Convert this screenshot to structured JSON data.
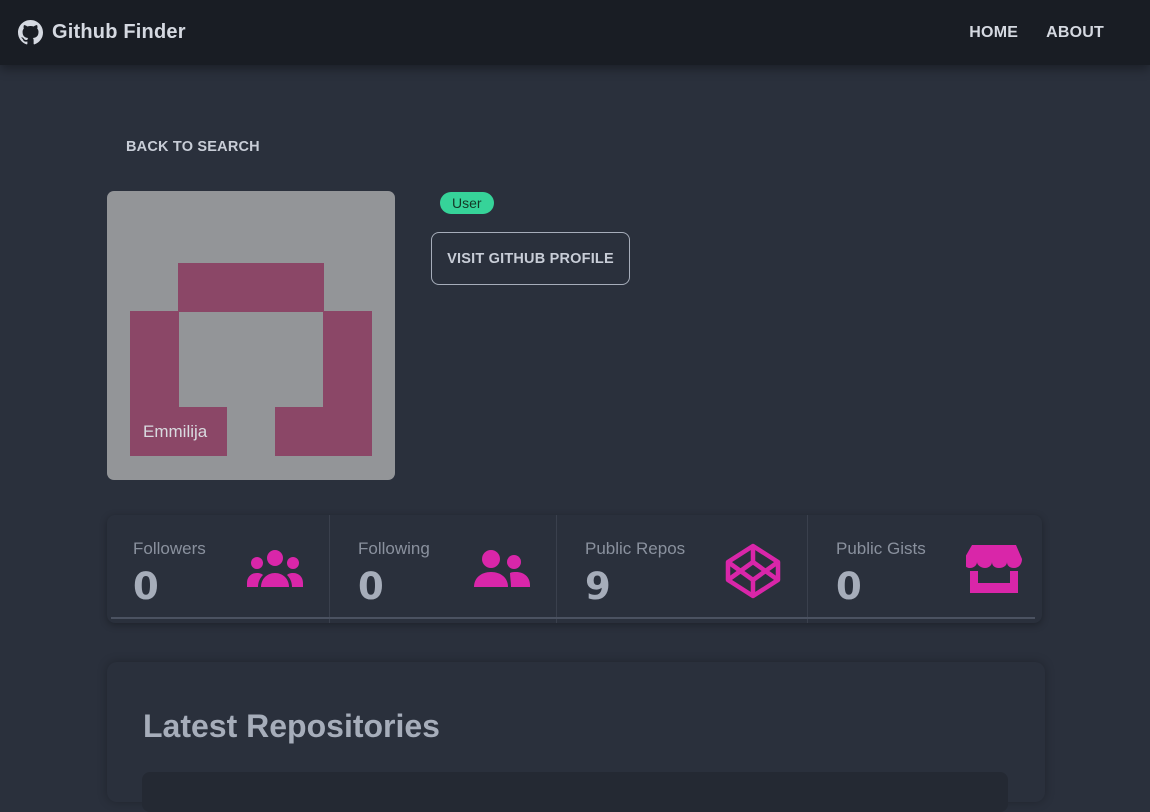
{
  "navbar": {
    "brand": "Github Finder",
    "brand_icon": "github-icon",
    "links": [
      "Home",
      "About"
    ]
  },
  "back_label": "Back To Search",
  "profile": {
    "login": "Emmilija",
    "type_badge": "User",
    "visit_label": "Visit Github Profile"
  },
  "stats": [
    {
      "label": "Followers",
      "value": "0",
      "icon": "users-icon"
    },
    {
      "label": "Following",
      "value": "0",
      "icon": "user-friends-icon"
    },
    {
      "label": "Public Repos",
      "value": "9",
      "icon": "codepen-icon"
    },
    {
      "label": "Public Gists",
      "value": "0",
      "icon": "store-icon"
    }
  ],
  "repos": {
    "title": "Latest Repositories"
  },
  "colors": {
    "accent": "#d926a9",
    "badge": "#36d399",
    "background": "#2a303c",
    "navbar": "#191d24",
    "identicon": "#8b4767",
    "identicon_bg": "#939598"
  }
}
